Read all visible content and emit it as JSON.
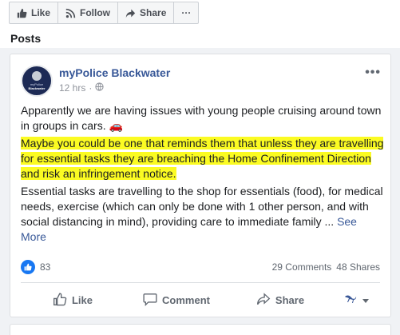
{
  "toolbar": {
    "like_label": "Like",
    "follow_label": "Follow",
    "share_label": "Share",
    "more_label": "···"
  },
  "posts_heading": "Posts",
  "post": {
    "avatar_line1": "myPolice",
    "avatar_line2": "Blackwater",
    "page_name": "myPolice Blackwater",
    "time": "12 hrs",
    "separator": "·",
    "more": "•••",
    "paragraph1": "Apparently we are having issues with young people cruising around town in groups in cars. 🚗",
    "paragraph2": "Maybe you could be one that reminds them that unless they are travelling for essential tasks they are breaching the Home Confinement Direction and risk an infringement notice.",
    "paragraph3": "Essential tasks are travelling to the shop for essentials (food), for medical needs, exercise (which can only be done with 1 other person, and with social distancing in mind), providing care to immediate family ...",
    "see_more": "See More",
    "reaction_count": "83",
    "comments": "29 Comments",
    "shares": "48 Shares",
    "actions": {
      "like": "Like",
      "comment": "Comment",
      "share": "Share"
    }
  },
  "colors": {
    "link": "#385898",
    "highlight": "#fbfb22",
    "like_blue": "#1877f2"
  }
}
